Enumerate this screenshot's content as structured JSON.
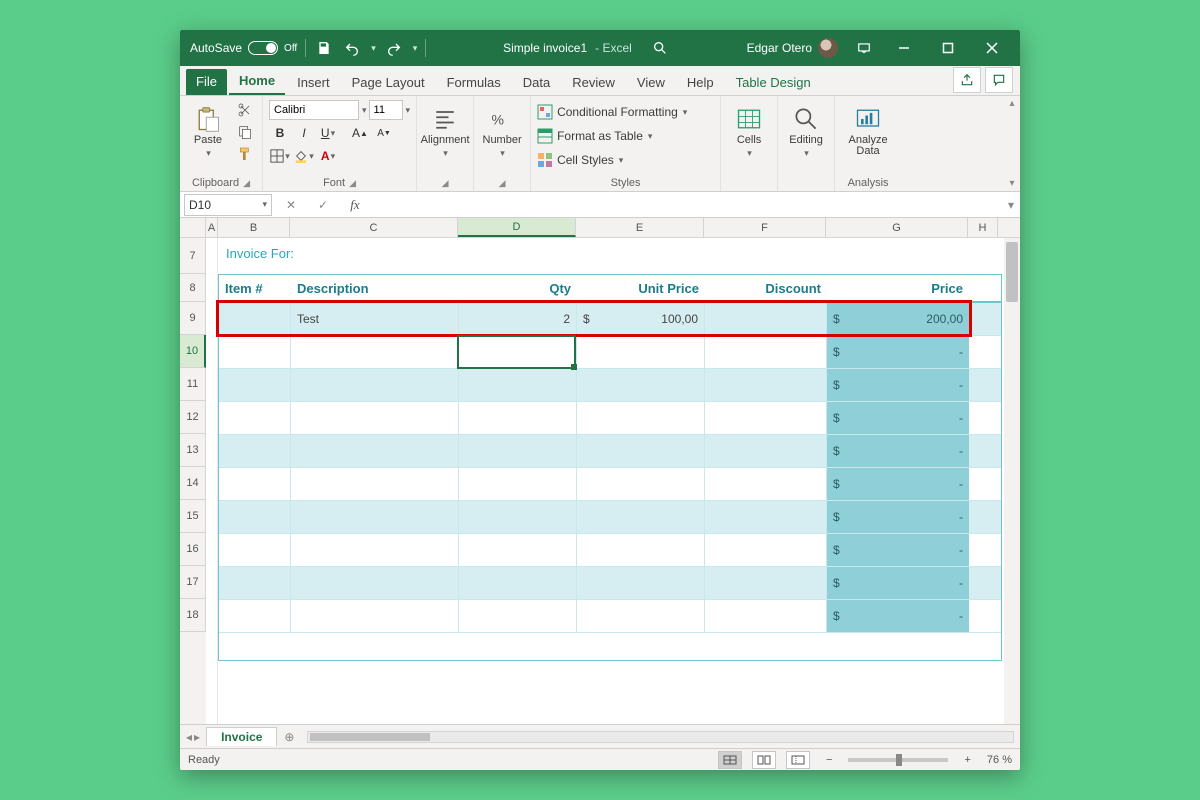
{
  "titlebar": {
    "autosave_label": "AutoSave",
    "autosave_state": "Off",
    "doc_name": "Simple invoice1",
    "app_suffix": " -  Excel",
    "user_name": "Edgar Otero"
  },
  "tabs": {
    "file": "File",
    "items": [
      "Home",
      "Insert",
      "Page Layout",
      "Formulas",
      "Data",
      "Review",
      "View",
      "Help"
    ],
    "active": "Home",
    "context": "Table Design"
  },
  "ribbon": {
    "clipboard": {
      "paste": "Paste",
      "label": "Clipboard"
    },
    "font": {
      "name": "Calibri",
      "size": "11",
      "label": "Font"
    },
    "alignment": {
      "label": "Alignment",
      "btn": "Alignment"
    },
    "number": {
      "label": "Number",
      "btn": "Number"
    },
    "styles": {
      "cond": "Conditional Formatting",
      "table": "Format as Table",
      "cell": "Cell Styles",
      "label": "Styles"
    },
    "cells": {
      "btn": "Cells",
      "label": "Cells"
    },
    "editing": {
      "btn": "Editing",
      "label": "Editing"
    },
    "analysis": {
      "btn": "Analyze\nData",
      "label": "Analysis"
    }
  },
  "formulabar": {
    "namebox": "D10",
    "fx": "fx",
    "value": ""
  },
  "columns": [
    {
      "letter": "A",
      "w": 12
    },
    {
      "letter": "B",
      "w": 72
    },
    {
      "letter": "C",
      "w": 168
    },
    {
      "letter": "D",
      "w": 118
    },
    {
      "letter": "E",
      "w": 128
    },
    {
      "letter": "F",
      "w": 122
    },
    {
      "letter": "G",
      "w": 142
    },
    {
      "letter": "H",
      "w": 30
    }
  ],
  "active_col": "D",
  "row_start": 7,
  "row_count": 12,
  "active_row": 10,
  "invoice": {
    "title": "Invoice For:",
    "headers": {
      "item": "Item #",
      "desc": "Description",
      "qty": "Qty",
      "unit": "Unit Price",
      "disc": "Discount",
      "price": "Price"
    },
    "rows": [
      {
        "item": "",
        "desc": "Test",
        "qty": "2",
        "unit_sym": "$",
        "unit": "100,00",
        "disc": "",
        "price_sym": "$",
        "price": "200,00"
      },
      {
        "price_sym": "$",
        "price": "-"
      },
      {
        "price_sym": "$",
        "price": "-"
      },
      {
        "price_sym": "$",
        "price": "-"
      },
      {
        "price_sym": "$",
        "price": "-"
      },
      {
        "price_sym": "$",
        "price": "-"
      },
      {
        "price_sym": "$",
        "price": "-"
      },
      {
        "price_sym": "$",
        "price": "-"
      },
      {
        "price_sym": "$",
        "price": "-"
      },
      {
        "price_sym": "$",
        "price": "-"
      }
    ]
  },
  "sheets": {
    "active": "Invoice"
  },
  "statusbar": {
    "ready": "Ready",
    "zoom": "76 %"
  }
}
